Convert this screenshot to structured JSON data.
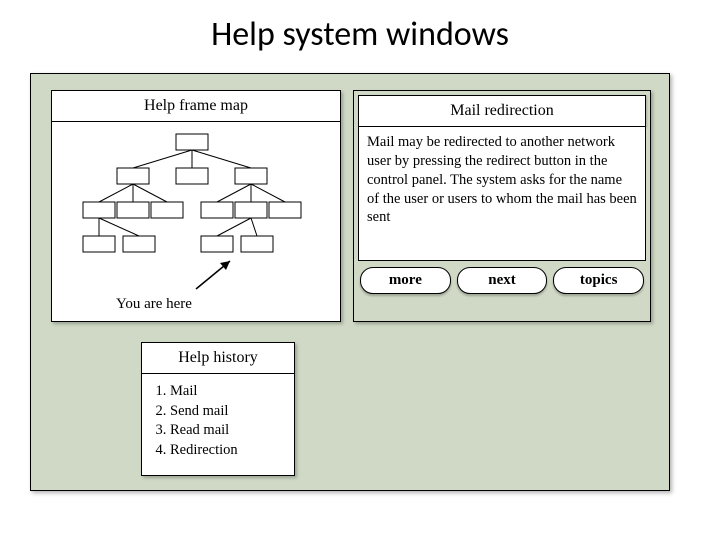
{
  "title": "Help system windows",
  "framemap": {
    "title": "Help frame map",
    "you_are_here": "You are here"
  },
  "redirection": {
    "title": "Mail redirection",
    "body": "Mail may be redirected to another network user by pressing the redirect button in the control panel. The system asks for the name of the user or users to whom the mail has been sent",
    "buttons": {
      "more": "more",
      "next": "next",
      "topics": "topics"
    }
  },
  "history": {
    "title": "Help history",
    "items": [
      "Mail",
      "Send mail",
      "Read mail",
      "Redirection"
    ]
  }
}
